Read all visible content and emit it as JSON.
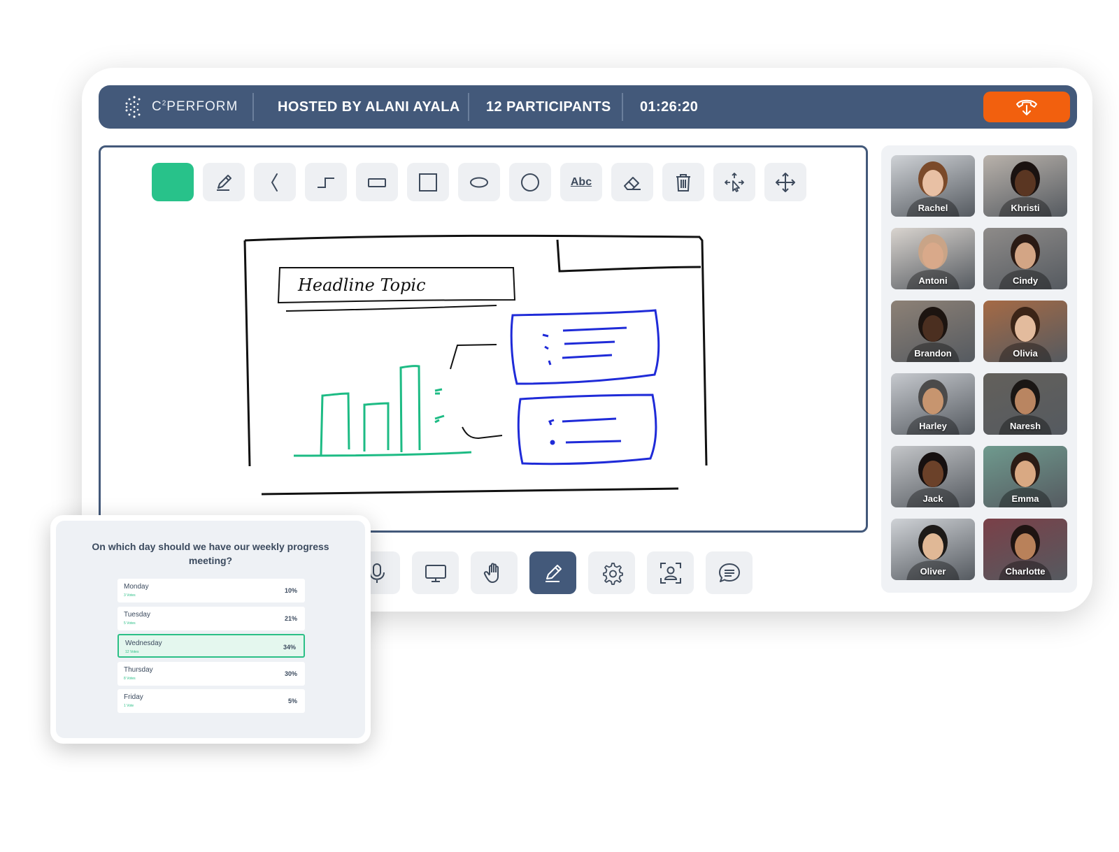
{
  "brand": {
    "name": "C²PERFORM",
    "name_main": "C",
    "name_sup": "2",
    "name_rest": "PERFORM"
  },
  "header": {
    "host": "HOSTED BY ALANI AYALA",
    "participants": "12 PARTICIPANTS",
    "timer": "01:26:20",
    "leave_icon": "phone-hangup-icon",
    "leave_color": "#f2600e"
  },
  "colors": {
    "header": "#43597a",
    "accent_green": "#28c28a",
    "pen_blue": "#1f2bd8"
  },
  "whiteboard": {
    "tools": [
      {
        "name": "color-swatch",
        "icon": "color-swatch",
        "color": "#28c28a"
      },
      {
        "name": "pen-tool",
        "icon": "pen-icon"
      },
      {
        "name": "freehand-tool",
        "icon": "freehand-line-icon"
      },
      {
        "name": "connector-tool",
        "icon": "elbow-line-icon"
      },
      {
        "name": "rectangle-tool",
        "icon": "rectangle-icon"
      },
      {
        "name": "square-tool",
        "icon": "square-icon"
      },
      {
        "name": "ellipse-tool",
        "icon": "ellipse-icon"
      },
      {
        "name": "circle-tool",
        "icon": "circle-icon"
      },
      {
        "name": "text-tool",
        "icon": "text-icon",
        "label": "Abc"
      },
      {
        "name": "eraser-tool",
        "icon": "eraser-icon"
      },
      {
        "name": "delete-tool",
        "icon": "trash-icon"
      },
      {
        "name": "select-tool",
        "icon": "select-move-icon"
      },
      {
        "name": "pan-tool",
        "icon": "move-arrows-icon"
      }
    ],
    "sketch_heading": "Headline Topic"
  },
  "controls": [
    {
      "name": "mic",
      "icon": "microphone-icon"
    },
    {
      "name": "screen-share",
      "icon": "monitor-icon"
    },
    {
      "name": "raise-hand",
      "icon": "hand-icon"
    },
    {
      "name": "whiteboard",
      "icon": "pen-icon",
      "active": true
    },
    {
      "name": "settings",
      "icon": "gear-icon"
    },
    {
      "name": "focus",
      "icon": "person-frame-icon"
    },
    {
      "name": "chat",
      "icon": "chat-bubble-icon"
    }
  ],
  "participants": [
    {
      "name": "Rachel",
      "bg": "#cfd2d6",
      "skin": "#e8c0a4",
      "hair": "#7b4a2a"
    },
    {
      "name": "Khristi",
      "bg": "#b9b2ab",
      "skin": "#5a3622",
      "hair": "#1a1210"
    },
    {
      "name": "Antoni",
      "bg": "#d9d4cf",
      "skin": "#d9a98a",
      "hair": "#c9a487"
    },
    {
      "name": "Cindy",
      "bg": "#8e8b89",
      "skin": "#d3a585",
      "hair": "#2a1a14"
    },
    {
      "name": "Brandon",
      "bg": "#8d8176",
      "skin": "#4b2f20",
      "hair": "#1c1410"
    },
    {
      "name": "Olivia",
      "bg": "#a56a45",
      "skin": "#e3bb9d",
      "hair": "#3b2417"
    },
    {
      "name": "Harley",
      "bg": "#c6c9ce",
      "skin": "#c7956f",
      "hair": "#4b4a4a"
    },
    {
      "name": "Naresh",
      "bg": "#63605b",
      "skin": "#b98561",
      "hair": "#1a1614"
    },
    {
      "name": "Jack",
      "bg": "#c4c6c9",
      "skin": "#6b4129",
      "hair": "#161010"
    },
    {
      "name": "Emma",
      "bg": "#6f9a8e",
      "skin": "#d9a983",
      "hair": "#2b1c15"
    },
    {
      "name": "Oliver",
      "bg": "#cfd2d6",
      "skin": "#e0b896",
      "hair": "#1d1a18"
    },
    {
      "name": "Charlotte",
      "bg": "#7a4048",
      "skin": "#b9815a",
      "hair": "#1f1412"
    }
  ],
  "poll": {
    "question": "On which day should we have our weekly progress meeting?",
    "options": [
      {
        "label": "Monday",
        "votes": "3 Votes",
        "percent": "10%",
        "selected": false
      },
      {
        "label": "Tuesday",
        "votes": "5 Votes",
        "percent": "21%",
        "selected": false
      },
      {
        "label": "Wednesday",
        "votes": "12 Votes",
        "percent": "34%",
        "selected": true
      },
      {
        "label": "Thursday",
        "votes": "8 Votes",
        "percent": "30%",
        "selected": false
      },
      {
        "label": "Friday",
        "votes": "1 Vote",
        "percent": "5%",
        "selected": false
      }
    ]
  }
}
